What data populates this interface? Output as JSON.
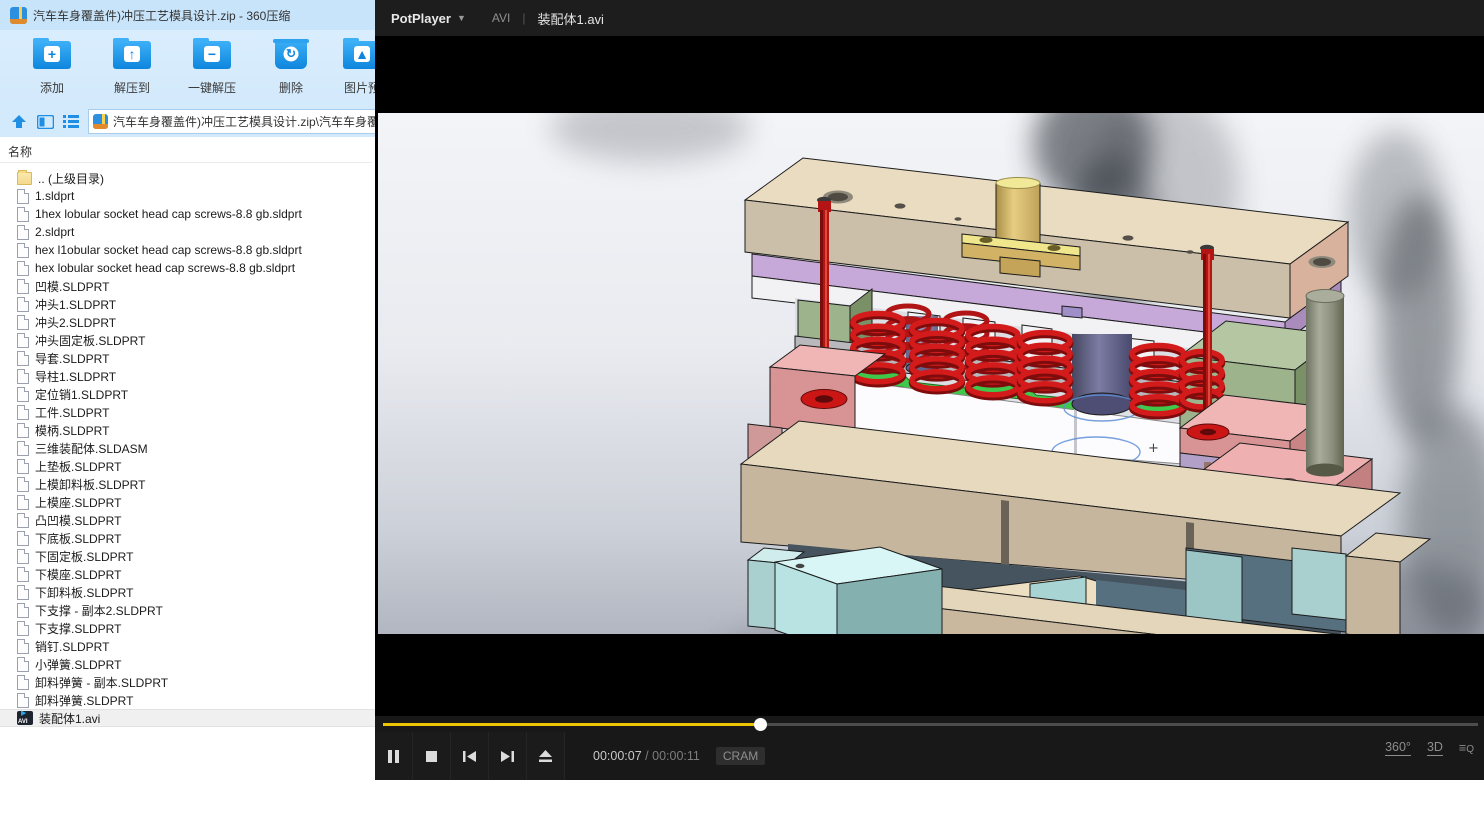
{
  "archive_window": {
    "title": "汽车车身覆盖件)冲压工艺模具设计.zip - 360压缩",
    "app_name": "360压缩",
    "toolbar": [
      {
        "id": "add",
        "label": "添加",
        "glyph": "+"
      },
      {
        "id": "extract-to",
        "label": "解压到",
        "glyph": "↑"
      },
      {
        "id": "one-click-extract",
        "label": "一键解压",
        "glyph": "−"
      },
      {
        "id": "delete",
        "label": "删除",
        "glyph": "↻"
      },
      {
        "id": "image-preview",
        "label": "图片预",
        "glyph": "▲"
      }
    ],
    "address_path": "汽车车身覆盖件)冲压工艺模具设计.zip\\汽车车身覆",
    "list_header": "名称",
    "files": [
      {
        "name": ".. (上级目录)",
        "type": "up"
      },
      {
        "name": "1.sldprt",
        "type": "f"
      },
      {
        "name": "1hex lobular socket head cap screws-8.8 gb.sldprt",
        "type": "f"
      },
      {
        "name": "2.sldprt",
        "type": "f"
      },
      {
        "name": "hex l1obular socket head cap screws-8.8 gb.sldprt",
        "type": "f"
      },
      {
        "name": "hex lobular socket head cap screws-8.8 gb.sldprt",
        "type": "f"
      },
      {
        "name": "凹模.SLDPRT",
        "type": "f"
      },
      {
        "name": "冲头1.SLDPRT",
        "type": "f"
      },
      {
        "name": "冲头2.SLDPRT",
        "type": "f"
      },
      {
        "name": "冲头固定板.SLDPRT",
        "type": "f"
      },
      {
        "name": "导套.SLDPRT",
        "type": "f"
      },
      {
        "name": "导柱1.SLDPRT",
        "type": "f"
      },
      {
        "name": "定位销1.SLDPRT",
        "type": "f"
      },
      {
        "name": "工件.SLDPRT",
        "type": "f"
      },
      {
        "name": "模柄.SLDPRT",
        "type": "f"
      },
      {
        "name": "三维装配体.SLDASM",
        "type": "f"
      },
      {
        "name": "上垫板.SLDPRT",
        "type": "f"
      },
      {
        "name": "上模卸料板.SLDPRT",
        "type": "f"
      },
      {
        "name": "上模座.SLDPRT",
        "type": "f"
      },
      {
        "name": "凸凹模.SLDPRT",
        "type": "f"
      },
      {
        "name": "下底板.SLDPRT",
        "type": "f"
      },
      {
        "name": "下固定板.SLDPRT",
        "type": "f"
      },
      {
        "name": "下模座.SLDPRT",
        "type": "f"
      },
      {
        "name": "下卸料板.SLDPRT",
        "type": "f"
      },
      {
        "name": "下支撑 - 副本2.SLDPRT",
        "type": "f"
      },
      {
        "name": "下支撑.SLDPRT",
        "type": "f"
      },
      {
        "name": "销钉.SLDPRT",
        "type": "f"
      },
      {
        "name": "小弹簧.SLDPRT",
        "type": "f"
      },
      {
        "name": "卸料弹簧 - 副本.SLDPRT",
        "type": "f"
      },
      {
        "name": "卸料弹簧.SLDPRT",
        "type": "f"
      },
      {
        "name": "装配体1.avi",
        "type": "avi",
        "selected": true
      }
    ]
  },
  "player": {
    "menu_label": "PotPlayer",
    "format_badge": "AVI",
    "title_separator": "|",
    "file_title": "装配体1.avi",
    "time_current": "00:00:07",
    "time_separator": "/",
    "time_total": "00:00:11",
    "codec": "CRAM",
    "right_controls": {
      "rotate": "360°",
      "stereo": "3D"
    },
    "accent_color": "#edc404"
  }
}
